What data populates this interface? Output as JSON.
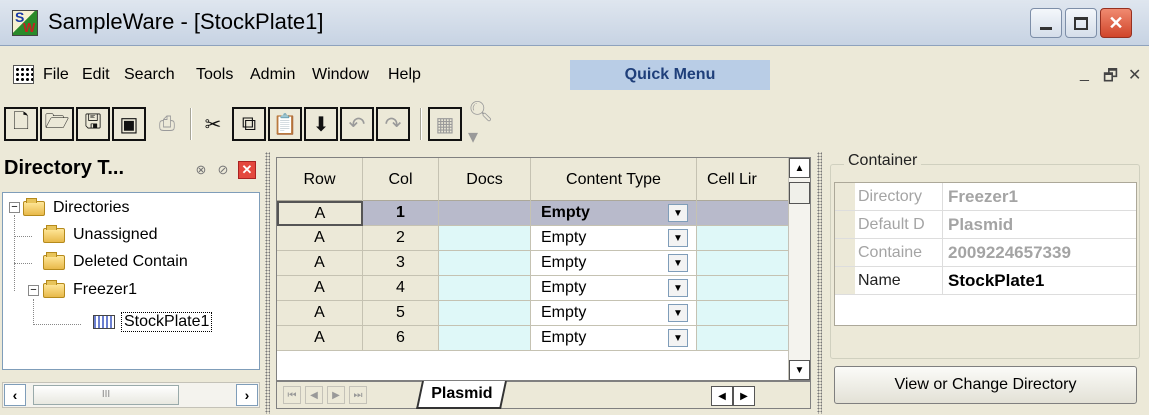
{
  "window": {
    "title": "SampleWare - [StockPlate1]",
    "icon_letters": {
      "top": "S",
      "bottom": "W"
    },
    "min_icon": "minimize-icon",
    "max_icon": "maximize-icon",
    "close_glyph": "✕"
  },
  "menu": {
    "items": [
      "File",
      "Edit",
      "Search",
      "Tools",
      "Admin",
      "Window",
      "Help"
    ],
    "quick_menu": "Quick Menu",
    "mdi_min": "_",
    "mdi_restore": "🗗",
    "mdi_close": "✕"
  },
  "toolbar": {
    "buttons": [
      "new",
      "open",
      "save",
      "save-all",
      "print",
      "cut",
      "copy",
      "paste",
      "move-down",
      "undo",
      "redo",
      "grid",
      "find"
    ]
  },
  "directory": {
    "title": "Directory T...",
    "tree": [
      {
        "label": "Directories"
      },
      {
        "label": "Unassigned"
      },
      {
        "label": "Deleted Contain"
      },
      {
        "label": "Freezer1"
      },
      {
        "label": "StockPlate1"
      }
    ],
    "scroll_thumb": "III"
  },
  "grid": {
    "columns": [
      "Row",
      "Col",
      "Docs",
      "Content Type",
      "Cell Lir"
    ],
    "rows": [
      {
        "row": "A",
        "col": "1",
        "docs": "",
        "content_type": "Empty"
      },
      {
        "row": "A",
        "col": "2",
        "docs": "",
        "content_type": "Empty"
      },
      {
        "row": "A",
        "col": "3",
        "docs": "",
        "content_type": "Empty"
      },
      {
        "row": "A",
        "col": "4",
        "docs": "",
        "content_type": "Empty"
      },
      {
        "row": "A",
        "col": "5",
        "docs": "",
        "content_type": "Empty"
      },
      {
        "row": "A",
        "col": "6",
        "docs": "",
        "content_type": "Empty"
      }
    ],
    "sheet_tab": "Plasmid"
  },
  "container": {
    "group_label": "Container",
    "properties": [
      {
        "name": "Directory",
        "value": "Freezer1"
      },
      {
        "name": "Default D",
        "value": "Plasmid"
      },
      {
        "name": "Containe",
        "value": "2009224657339"
      },
      {
        "name": "Name",
        "value": "StockPlate1"
      }
    ],
    "view_button": "View or Change Directory"
  },
  "colors": {
    "title_bar": "#c7d3e3",
    "quick_menu_bg": "#b9cde6",
    "selected_row": "#b8bacb",
    "cell_cyan": "#dff8f8",
    "close_red": "#d0452a"
  }
}
